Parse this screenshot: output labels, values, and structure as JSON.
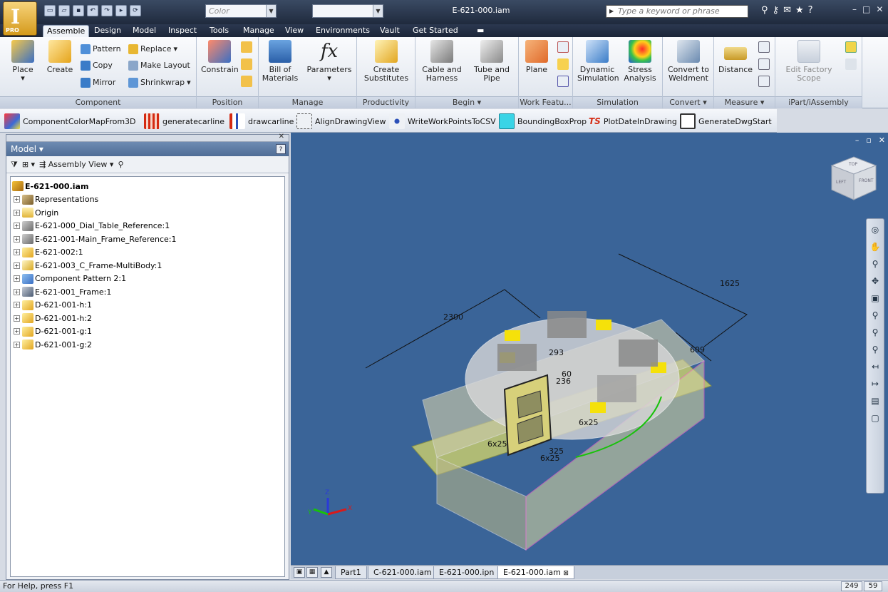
{
  "window": {
    "title": "E-621-000.iam",
    "pro_badge": "PRO",
    "color_combo": "Color",
    "search_placeholder": "Type a keyword or phrase"
  },
  "ribbon_tabs": [
    "Assemble",
    "Design",
    "Model",
    "Inspect",
    "Tools",
    "Manage",
    "View",
    "Environments",
    "Vault",
    "Get Started"
  ],
  "active_tab": "Assemble",
  "panels": {
    "component": {
      "title": "Component",
      "place": "Place",
      "create": "Create",
      "pattern": "Pattern",
      "replace": "Replace",
      "copy": "Copy",
      "make_layout": "Make Layout",
      "mirror": "Mirror",
      "shrinkwrap": "Shrinkwrap"
    },
    "position": {
      "title": "Position",
      "constrain": "Constrain"
    },
    "manage": {
      "title": "Manage",
      "bom": "Bill of Materials",
      "parameters": "Parameters"
    },
    "productivity": {
      "title": "Productivity",
      "create_substitutes": "Create Substitutes"
    },
    "begin": {
      "title": "Begin",
      "cable": "Cable and Harness",
      "tube": "Tube and Pipe"
    },
    "work": {
      "title": "Work Featu...",
      "plane": "Plane"
    },
    "simulation": {
      "title": "Simulation",
      "dynamic": "Dynamic Simulation",
      "stress": "Stress Analysis"
    },
    "convert": {
      "title": "Convert",
      "weldment": "Convert to Weldment"
    },
    "measure": {
      "title": "Measure",
      "distance": "Distance"
    },
    "ipart": {
      "title": "iPart/iAssembly",
      "factory": "Edit Factory Scope"
    }
  },
  "addins": [
    "ComponentColorMapFrom3D",
    "generatecarline",
    "drawcarline",
    "AlignDrawingView",
    "WriteWorkPointsToCSV",
    "BoundingBoxProp",
    "PlotDateInDrawing",
    "GenerateDwgStart"
  ],
  "addin_ts_badge": "TS",
  "browser": {
    "title": "Model",
    "view_mode": "Assembly View",
    "root": "E-621-000.iam",
    "nodes": [
      "Representations",
      "Origin",
      "E-621-000_Dial_Table_Reference:1",
      "E-621-001-Main_Frame_Reference:1",
      "E-621-002:1",
      "E-621-003_C_Frame-MultiBody:1",
      "Component Pattern 2:1",
      "E-621-001_Frame:1",
      "D-621-001-h:1",
      "D-621-001-h:2",
      "D-621-001-g:1",
      "D-621-001-g:2"
    ]
  },
  "viewport": {
    "dimensions": [
      "2300",
      "1625",
      "609",
      "293",
      "60",
      "236",
      "6x25",
      "6x25",
      "6x25",
      "325"
    ],
    "viewcube_faces": [
      "TOP",
      "LEFT",
      "FRONT"
    ]
  },
  "doc_tabs": [
    "Part1",
    "C-621-000.iam",
    "E-621-000.ipn",
    "E-621-000.iam"
  ],
  "active_doc": "E-621-000.iam",
  "status": {
    "help": "For Help, press F1",
    "count1": "249",
    "count2": "59"
  }
}
